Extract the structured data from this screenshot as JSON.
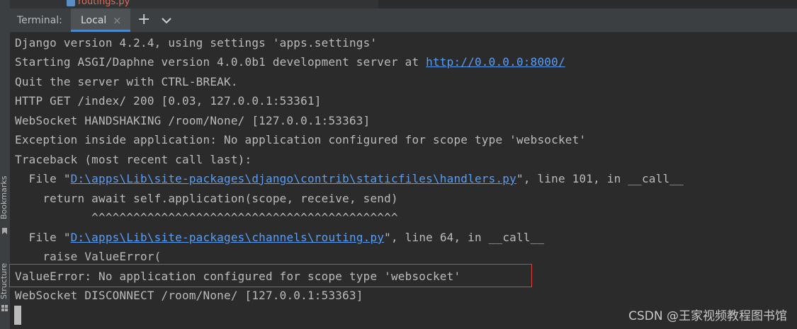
{
  "editor": {
    "file_tab": "routings.py"
  },
  "sidebar": {
    "bookmarks_label": "Bookmarks",
    "structure_label": "Structure"
  },
  "terminal_tabs": {
    "title": "Terminal:",
    "active_tab": "Local",
    "close_glyph": "×",
    "add_glyph": "+"
  },
  "output": {
    "l1": "Django version 4.2.4, using settings 'apps.settings'",
    "l2_pre": "Starting ASGI/Daphne version 4.0.0b1 development server at ",
    "l2_link": "http://0.0.0.0:8000/",
    "l3": "Quit the server with CTRL-BREAK.",
    "l4": "HTTP GET /index/ 200 [0.03, 127.0.0.1:53361]",
    "l5": "WebSocket HANDSHAKING /room/None/ [127.0.0.1:53363]",
    "l6": "Exception inside application: No application configured for scope type 'websocket'",
    "l7": "Traceback (most recent call last):",
    "l8_pre": "  File \"",
    "l8_link": "D:\\apps\\Lib\\site-packages\\django\\contrib\\staticfiles\\handlers.py",
    "l8_post": "\", line 101, in __call__",
    "l9": "    return await self.application(scope, receive, send)",
    "l10": "           ^^^^^^^^^^^^^^^^^^^^^^^^^^^^^^^^^^^^^^^^^^^^",
    "l11_pre": "  File \"",
    "l11_link": "D:\\apps\\Lib\\site-packages\\channels\\routing.py",
    "l11_post": "\", line 64, in __call__",
    "l12": "    raise ValueError(",
    "l13": "ValueError: No application configured for scope type 'websocket'",
    "l14": "WebSocket DISCONNECT /room/None/ [127.0.0.1:53363]"
  },
  "watermark": "CSDN @王家视频教程图书馆",
  "colors": {
    "link": "#589df6",
    "highlight_box": "#e0403c",
    "tab_underline": "#4a88c7",
    "error_file": "#e06c5a"
  }
}
